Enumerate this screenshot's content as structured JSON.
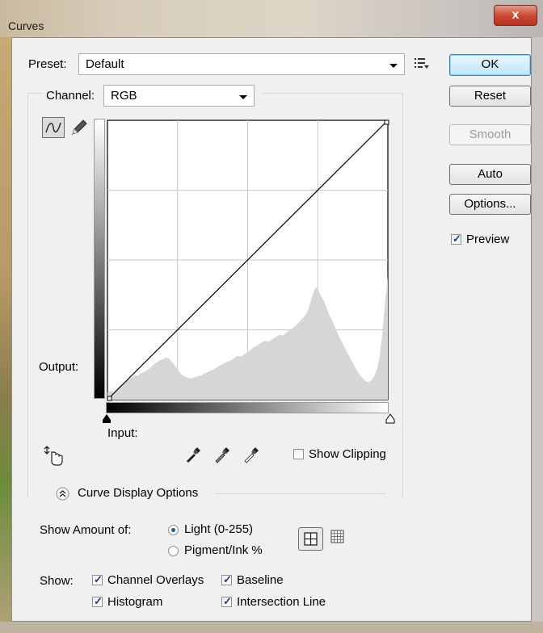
{
  "window": {
    "title": "Curves",
    "close": "x"
  },
  "preset": {
    "label": "Preset:",
    "value": "Default"
  },
  "channel": {
    "label": "Channel:",
    "value": "RGB"
  },
  "curve": {
    "output_label": "Output:",
    "input_label": "Input:",
    "histogram": [
      8,
      10,
      9,
      12,
      15,
      17,
      19,
      22,
      24,
      26,
      28,
      27,
      30,
      31,
      33,
      35,
      38,
      41,
      43,
      45,
      46,
      48,
      47,
      44,
      40,
      36,
      31,
      28,
      26,
      25,
      24,
      25,
      26,
      27,
      28,
      30,
      31,
      33,
      34,
      36,
      38,
      40,
      41,
      43,
      44,
      46,
      48,
      50,
      49,
      51,
      53,
      55,
      58,
      60,
      62,
      64,
      66,
      67,
      66,
      68,
      70,
      72,
      74,
      73,
      75,
      78,
      80,
      82,
      85,
      88,
      92,
      95,
      100,
      110,
      120,
      128,
      124,
      118,
      112,
      104,
      96,
      90,
      82,
      75,
      68,
      62,
      56,
      50,
      44,
      38,
      32,
      28,
      24,
      21,
      20,
      22,
      26,
      34,
      48,
      75,
      112,
      140
    ],
    "line_start": [
      0,
      0
    ],
    "line_end": [
      255,
      255
    ]
  },
  "buttons": {
    "ok": "OK",
    "reset": "Reset",
    "smooth": "Smooth",
    "auto": "Auto",
    "options": "Options..."
  },
  "preview": {
    "label": "Preview",
    "checked": true
  },
  "show_clipping": {
    "label": "Show Clipping",
    "checked": false
  },
  "curve_display_options": {
    "label": "Curve Display Options"
  },
  "show_amount": {
    "label": "Show Amount of:",
    "light": "Light  (0-255)",
    "pigment": "Pigment/Ink %",
    "selected": "light"
  },
  "show": {
    "label": "Show:",
    "channel_overlays": "Channel Overlays",
    "baseline": "Baseline",
    "histogram": "Histogram",
    "intersection_line": "Intersection Line"
  },
  "colors": {
    "accent": "#3c7fb1",
    "close_button": "#c8452f"
  }
}
